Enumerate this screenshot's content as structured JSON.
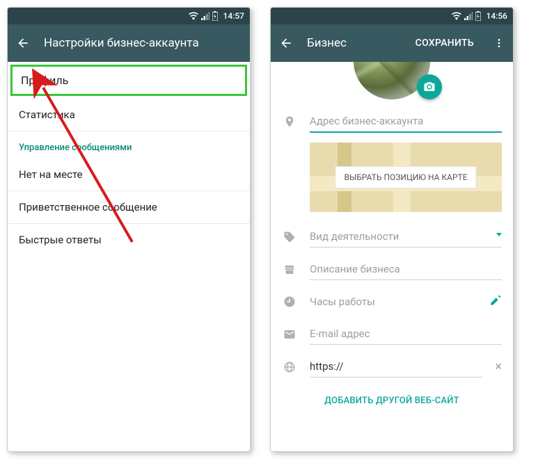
{
  "left": {
    "statusbar": {
      "time": "14:57"
    },
    "appbar": {
      "title": "Настройки бизнес-аккаунта"
    },
    "items": {
      "profile": "Профиль",
      "stats": "Статистика",
      "section": "Управление сообщениями",
      "away": "Нет на месте",
      "greeting": "Приветственное сообщение",
      "quick": "Быстрые ответы"
    }
  },
  "right": {
    "statusbar": {
      "time": "14:56"
    },
    "appbar": {
      "title": "Бизнес",
      "action": "СОХРАНИТЬ"
    },
    "fields": {
      "address": "Адрес бизнес-аккаунта",
      "mapbtn": "ВЫБРАТЬ ПОЗИЦИЮ НА КАРТЕ",
      "category": "Вид деятельности",
      "description": "Описание бизнеса",
      "hours": "Часы работы",
      "email": "E-mail адрес",
      "website": "https://",
      "addsite": "ДОБАВИТЬ ДРУГОЙ ВЕБ-САЙТ"
    }
  }
}
